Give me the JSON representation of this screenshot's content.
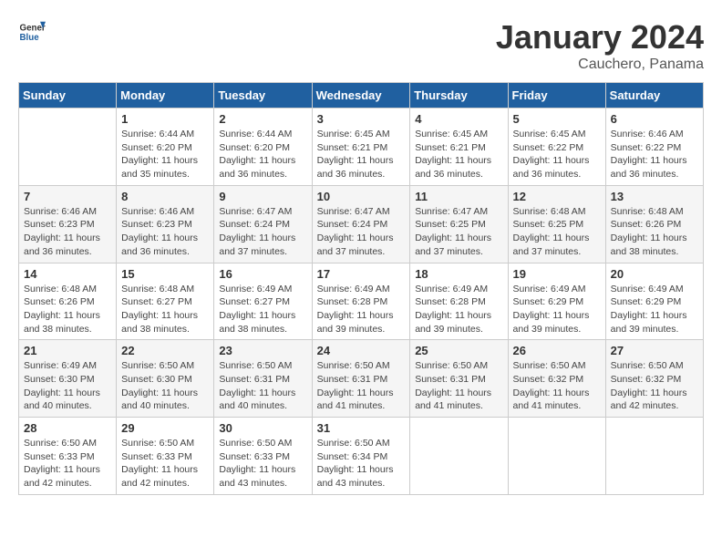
{
  "logo": {
    "text_general": "General",
    "text_blue": "Blue"
  },
  "title": "January 2024",
  "location": "Cauchero, Panama",
  "days_of_week": [
    "Sunday",
    "Monday",
    "Tuesday",
    "Wednesday",
    "Thursday",
    "Friday",
    "Saturday"
  ],
  "weeks": [
    [
      {
        "day": "",
        "info": ""
      },
      {
        "day": "1",
        "info": "Sunrise: 6:44 AM\nSunset: 6:20 PM\nDaylight: 11 hours and 35 minutes."
      },
      {
        "day": "2",
        "info": "Sunrise: 6:44 AM\nSunset: 6:20 PM\nDaylight: 11 hours and 36 minutes."
      },
      {
        "day": "3",
        "info": "Sunrise: 6:45 AM\nSunset: 6:21 PM\nDaylight: 11 hours and 36 minutes."
      },
      {
        "day": "4",
        "info": "Sunrise: 6:45 AM\nSunset: 6:21 PM\nDaylight: 11 hours and 36 minutes."
      },
      {
        "day": "5",
        "info": "Sunrise: 6:45 AM\nSunset: 6:22 PM\nDaylight: 11 hours and 36 minutes."
      },
      {
        "day": "6",
        "info": "Sunrise: 6:46 AM\nSunset: 6:22 PM\nDaylight: 11 hours and 36 minutes."
      }
    ],
    [
      {
        "day": "7",
        "info": "Sunrise: 6:46 AM\nSunset: 6:23 PM\nDaylight: 11 hours and 36 minutes."
      },
      {
        "day": "8",
        "info": "Sunrise: 6:46 AM\nSunset: 6:23 PM\nDaylight: 11 hours and 36 minutes."
      },
      {
        "day": "9",
        "info": "Sunrise: 6:47 AM\nSunset: 6:24 PM\nDaylight: 11 hours and 37 minutes."
      },
      {
        "day": "10",
        "info": "Sunrise: 6:47 AM\nSunset: 6:24 PM\nDaylight: 11 hours and 37 minutes."
      },
      {
        "day": "11",
        "info": "Sunrise: 6:47 AM\nSunset: 6:25 PM\nDaylight: 11 hours and 37 minutes."
      },
      {
        "day": "12",
        "info": "Sunrise: 6:48 AM\nSunset: 6:25 PM\nDaylight: 11 hours and 37 minutes."
      },
      {
        "day": "13",
        "info": "Sunrise: 6:48 AM\nSunset: 6:26 PM\nDaylight: 11 hours and 38 minutes."
      }
    ],
    [
      {
        "day": "14",
        "info": "Sunrise: 6:48 AM\nSunset: 6:26 PM\nDaylight: 11 hours and 38 minutes."
      },
      {
        "day": "15",
        "info": "Sunrise: 6:48 AM\nSunset: 6:27 PM\nDaylight: 11 hours and 38 minutes."
      },
      {
        "day": "16",
        "info": "Sunrise: 6:49 AM\nSunset: 6:27 PM\nDaylight: 11 hours and 38 minutes."
      },
      {
        "day": "17",
        "info": "Sunrise: 6:49 AM\nSunset: 6:28 PM\nDaylight: 11 hours and 39 minutes."
      },
      {
        "day": "18",
        "info": "Sunrise: 6:49 AM\nSunset: 6:28 PM\nDaylight: 11 hours and 39 minutes."
      },
      {
        "day": "19",
        "info": "Sunrise: 6:49 AM\nSunset: 6:29 PM\nDaylight: 11 hours and 39 minutes."
      },
      {
        "day": "20",
        "info": "Sunrise: 6:49 AM\nSunset: 6:29 PM\nDaylight: 11 hours and 39 minutes."
      }
    ],
    [
      {
        "day": "21",
        "info": "Sunrise: 6:49 AM\nSunset: 6:30 PM\nDaylight: 11 hours and 40 minutes."
      },
      {
        "day": "22",
        "info": "Sunrise: 6:50 AM\nSunset: 6:30 PM\nDaylight: 11 hours and 40 minutes."
      },
      {
        "day": "23",
        "info": "Sunrise: 6:50 AM\nSunset: 6:31 PM\nDaylight: 11 hours and 40 minutes."
      },
      {
        "day": "24",
        "info": "Sunrise: 6:50 AM\nSunset: 6:31 PM\nDaylight: 11 hours and 41 minutes."
      },
      {
        "day": "25",
        "info": "Sunrise: 6:50 AM\nSunset: 6:31 PM\nDaylight: 11 hours and 41 minutes."
      },
      {
        "day": "26",
        "info": "Sunrise: 6:50 AM\nSunset: 6:32 PM\nDaylight: 11 hours and 41 minutes."
      },
      {
        "day": "27",
        "info": "Sunrise: 6:50 AM\nSunset: 6:32 PM\nDaylight: 11 hours and 42 minutes."
      }
    ],
    [
      {
        "day": "28",
        "info": "Sunrise: 6:50 AM\nSunset: 6:33 PM\nDaylight: 11 hours and 42 minutes."
      },
      {
        "day": "29",
        "info": "Sunrise: 6:50 AM\nSunset: 6:33 PM\nDaylight: 11 hours and 42 minutes."
      },
      {
        "day": "30",
        "info": "Sunrise: 6:50 AM\nSunset: 6:33 PM\nDaylight: 11 hours and 43 minutes."
      },
      {
        "day": "31",
        "info": "Sunrise: 6:50 AM\nSunset: 6:34 PM\nDaylight: 11 hours and 43 minutes."
      },
      {
        "day": "",
        "info": ""
      },
      {
        "day": "",
        "info": ""
      },
      {
        "day": "",
        "info": ""
      }
    ]
  ]
}
